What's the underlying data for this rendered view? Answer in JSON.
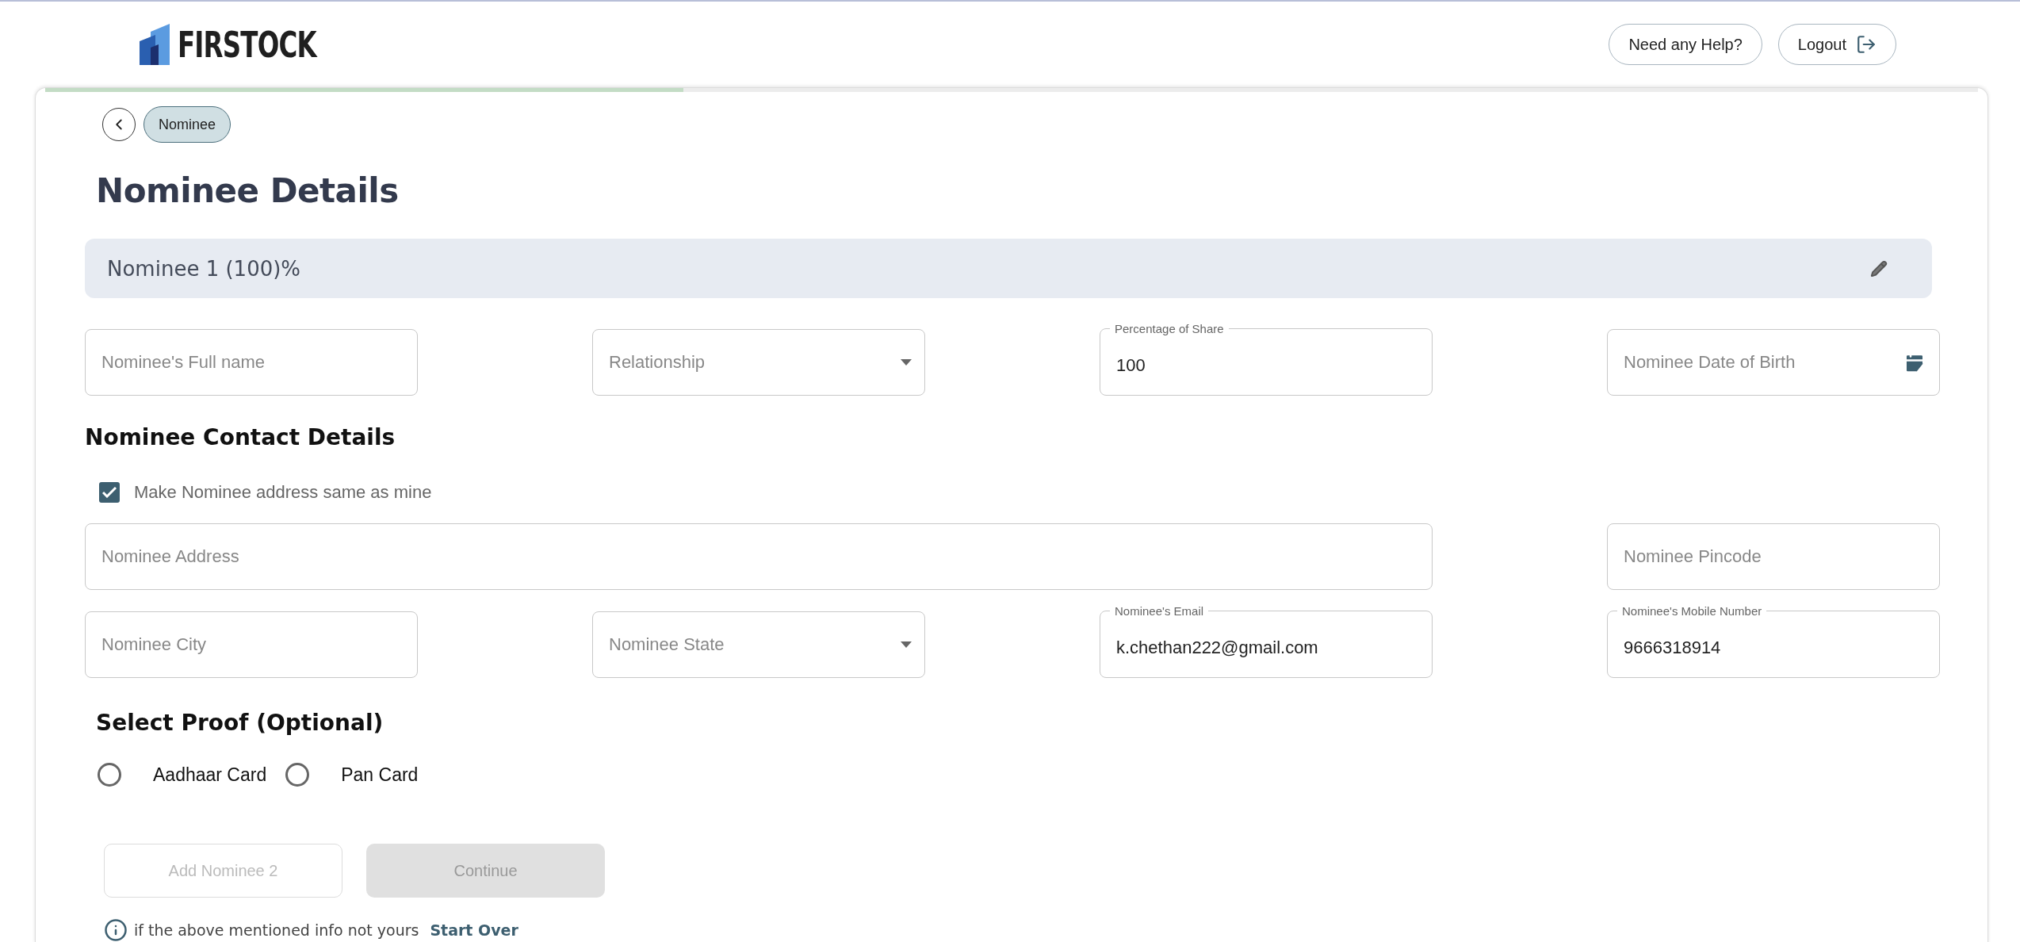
{
  "header": {
    "logo_text": "FIRSTOCK",
    "buttons": [
      {
        "kind": "help",
        "label": "Need any Help?"
      },
      {
        "kind": "logout",
        "label": "Logout"
      }
    ]
  },
  "progress": {
    "level": 0.33
  },
  "breadcrumb": {
    "chip": "Nominee"
  },
  "title": "Nominee Details",
  "nominee_bar": {
    "label": "Nominee 1 (100)%"
  },
  "nominee_fields": [
    {
      "kind": "text",
      "placeholder": "Nominee's Full name"
    },
    {
      "kind": "select",
      "placeholder": "Relationship"
    },
    {
      "kind": "text",
      "label": "Percentage of Share",
      "value": "100"
    },
    {
      "kind": "date",
      "placeholder": "Nominee Date of Birth"
    }
  ],
  "contact_heading": "Nominee Contact Details",
  "same_address": {
    "label": "Make Nominee address same as mine",
    "checked": true
  },
  "contact_rows": [
    [
      {
        "kind": "text",
        "placeholder": "Nominee Address"
      },
      {
        "kind": "text",
        "placeholder": "Nominee Pincode"
      }
    ],
    [
      {
        "kind": "text",
        "placeholder": "Nominee City"
      },
      {
        "kind": "select",
        "placeholder": "Nominee State"
      },
      {
        "kind": "text",
        "label": "Nominee's Email",
        "value": "k.chethan222@gmail.com"
      },
      {
        "kind": "text",
        "label": "Nominee's Mobile Number",
        "value": "9666318914"
      }
    ]
  ],
  "proof": {
    "heading": "Select Proof (Optional)",
    "options": [
      {
        "label": "Aadhaar Card",
        "selected": false
      },
      {
        "label": "Pan Card",
        "selected": false
      }
    ]
  },
  "actions": [
    {
      "kind": "outline",
      "label": "Add Nominee 2",
      "disabled": true
    },
    {
      "kind": "filled",
      "label": "Continue",
      "disabled": true
    }
  ],
  "info": {
    "text": "if the above mentioned info not yours",
    "link": "Start Over"
  }
}
